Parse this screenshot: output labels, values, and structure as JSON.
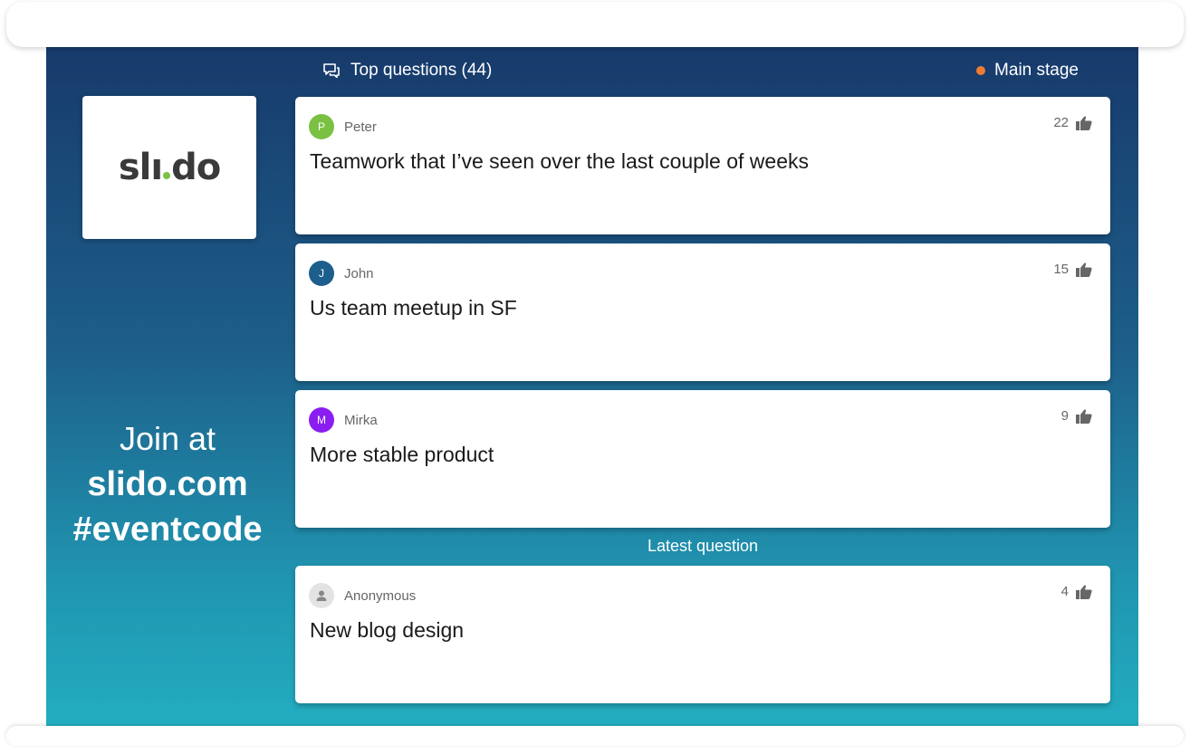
{
  "header": {
    "top_questions_label": "Top questions (44)",
    "stage_label": "Main stage"
  },
  "brand": {
    "logo_part1": "sl",
    "logo_part2": "ı",
    "logo_part3": "do"
  },
  "join": {
    "line1": "Join at",
    "line2": "slido.com",
    "line3": "#eventcode"
  },
  "questions": [
    {
      "author": "Peter",
      "initial": "P",
      "avatar_color": "#7ac143",
      "votes": "22",
      "text": "Teamwork that I’ve seen over the last couple of weeks"
    },
    {
      "author": "John",
      "initial": "J",
      "avatar_color": "#1c5e8c",
      "votes": "15",
      "text": "Us team meetup in SF"
    },
    {
      "author": "Mirka",
      "initial": "M",
      "avatar_color": "#8a1ef0",
      "votes": "9",
      "text": "More stable product"
    }
  ],
  "latest": {
    "label": "Latest question",
    "question": {
      "author": "Anonymous",
      "avatar_color": "#e3e3e3",
      "votes": "4",
      "text": "New blog design"
    }
  },
  "colors": {
    "accent_dot": "#ef7d31",
    "logo_dot": "#7ac143"
  },
  "icons": {
    "header": "comments-icon",
    "vote": "thumbs-up-icon",
    "anonymous": "person-icon"
  }
}
